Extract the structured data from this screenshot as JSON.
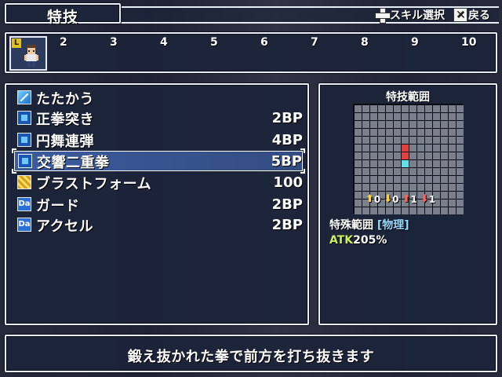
{
  "header": {
    "title": "特技",
    "hints": [
      {
        "icon": "dpad-icon",
        "label": "スキル選択"
      },
      {
        "icon": "x-button-icon",
        "label": "戻る"
      }
    ]
  },
  "party": {
    "leader_badge": "L",
    "slots": [
      "2",
      "3",
      "4",
      "5",
      "6",
      "7",
      "8",
      "9",
      "10"
    ]
  },
  "skills": [
    {
      "name": "たたかう",
      "cost": "",
      "icon": "attack-icon"
    },
    {
      "name": "正拳突き",
      "cost": "2BP",
      "icon": "special-skill-icon"
    },
    {
      "name": "円舞連弾",
      "cost": "4BP",
      "icon": "special-skill-icon"
    },
    {
      "name": "交響二重拳",
      "cost": "5BP",
      "icon": "special-skill-icon",
      "selected": true
    },
    {
      "name": "ブラストフォーム",
      "cost": "100",
      "icon": "form-icon"
    },
    {
      "name": "ガード",
      "cost": "2BP",
      "icon": "da-icon"
    },
    {
      "name": "アクセル",
      "cost": "2BP",
      "icon": "da-icon"
    }
  ],
  "da_label": "Da",
  "range": {
    "title": "特技範囲",
    "highlighted_cells": [
      {
        "col": 6,
        "row": 5,
        "color": "#e04040"
      },
      {
        "col": 6,
        "row": 6,
        "color": "#e04040"
      },
      {
        "col": 6,
        "row": 7,
        "color": "#60e0e8"
      }
    ],
    "modifiers": [
      {
        "arrow": "up-yellow",
        "glyph": "⬆",
        "value": "0"
      },
      {
        "arrow": "down-yellow",
        "glyph": "⬇",
        "value": "0"
      },
      {
        "arrow": "up-red",
        "glyph": "⬆",
        "value": "1"
      },
      {
        "arrow": "down-red",
        "glyph": "⬇",
        "value": "1"
      }
    ],
    "type_label": "特殊範囲",
    "type_tag": "[物理]",
    "atk_label": "ATK",
    "atk_value": "205%"
  },
  "description": "鍛え抜かれた拳で前方を打ち抜きます",
  "colors": {
    "panel_border": "#e8ecf4",
    "panel_bg": "#1c243a",
    "selected_row": "#466ebe",
    "atk_label": "#c8f060",
    "type_tag": "#9ad8ff"
  }
}
